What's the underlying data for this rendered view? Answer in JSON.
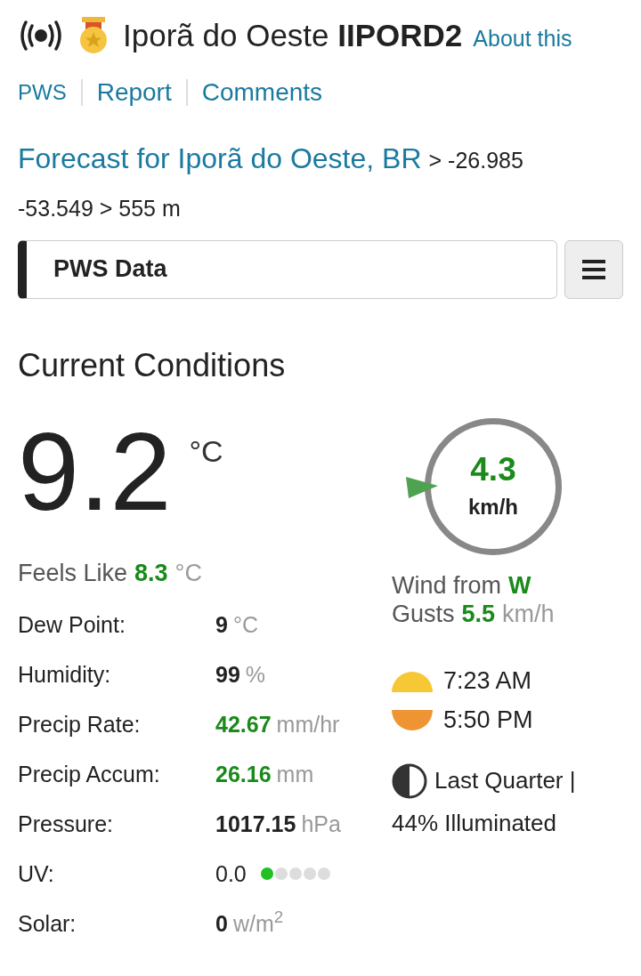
{
  "station": {
    "name": "Iporã do Oeste",
    "id": "IIPORD2",
    "about": "About this"
  },
  "nav": [
    {
      "label": "PWS"
    },
    {
      "label": "Report"
    },
    {
      "label": "Comments"
    }
  ],
  "forecast": {
    "link": "Forecast for Iporã do Oeste, BR",
    "details": "> -26.985",
    "details_2": "-53.549 > 555 m"
  },
  "dropdown": {
    "label": "PWS Data"
  },
  "heading": "Current Conditions",
  "temperature": {
    "value": "9.2",
    "unit": "°C"
  },
  "feels_like": {
    "label": "Feels Like",
    "value": "8.3",
    "unit": "°C"
  },
  "rows": [
    {
      "label": "Dew Point:",
      "value": "9",
      "unit": "°C",
      "highlight": false,
      "kind": "plain"
    },
    {
      "label": "Humidity:",
      "value": "99",
      "unit": "%",
      "highlight": false,
      "kind": "plain"
    },
    {
      "label": "Precip Rate:",
      "value": "42.67",
      "unit": "mm/hr",
      "highlight": true,
      "kind": "plain"
    },
    {
      "label": "Precip Accum:",
      "value": "26.16",
      "unit": "mm",
      "highlight": true,
      "kind": "plain"
    },
    {
      "label": "Pressure:",
      "value": "1017.15",
      "unit": "hPa",
      "highlight": false,
      "kind": "plain"
    },
    {
      "label": "UV:",
      "value": "0.0",
      "kind": "uv",
      "level": 0.2
    },
    {
      "label": "Solar:",
      "value": "0",
      "unit": "w/m$^{2}$",
      "highlight": false,
      "kind": "plain"
    }
  ],
  "wind": {
    "speed": "4.3",
    "unit": "km/h",
    "from_label": "Wind from",
    "direction": "W",
    "gusts_label": "Gusts",
    "gusts": "5.5",
    "gusts_unit": "km/h"
  },
  "sun": {
    "sunrise": "7:23 AM",
    "sunset": "5:50 PM"
  },
  "moon": {
    "phase": "Last Quarter |",
    "illumination": "44% Illuminated"
  }
}
